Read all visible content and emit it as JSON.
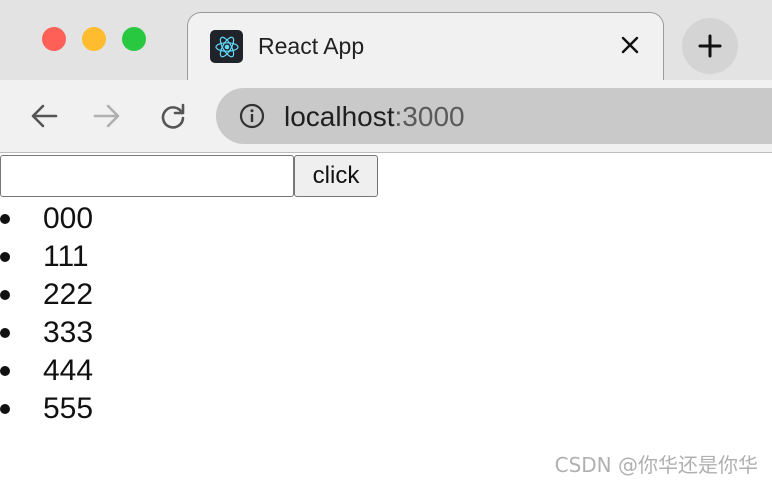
{
  "browser": {
    "tab": {
      "title": "React App",
      "close_glyph": "×",
      "favicon": "react-logo-icon"
    },
    "new_tab_glyph": "+",
    "toolbar": {
      "back_icon": "arrow-left-icon",
      "forward_icon": "arrow-right-icon",
      "reload_icon": "reload-icon"
    },
    "address": {
      "host": "localhost",
      "port": ":3000",
      "info_icon": "info-icon"
    },
    "colors": {
      "close": "#fe5f57",
      "minimize": "#febc2e",
      "maximize": "#28c840",
      "react_accent": "#61dafb"
    }
  },
  "page": {
    "input": {
      "value": "",
      "placeholder": ""
    },
    "button_label": "click",
    "items": [
      "000",
      "111",
      "222",
      "333",
      "444",
      "555"
    ]
  },
  "watermark": "CSDN @你华还是你华"
}
